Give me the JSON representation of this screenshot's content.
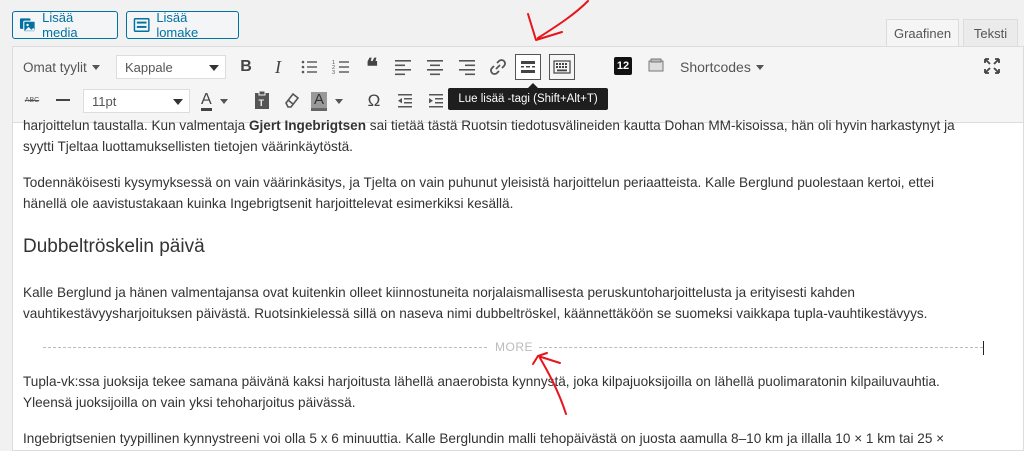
{
  "media_buttons": {
    "add_media": "Lisää media",
    "add_form": "Lisää lomake"
  },
  "tabs": {
    "visual": "Graafinen",
    "text": "Teksti"
  },
  "toolbar": {
    "styles_label": "Omat tyylit",
    "format_select": "Kappale",
    "font_size_select": "11pt",
    "counter_badge": "12",
    "shortcodes_label": "Shortcodes",
    "strikethrough_label": "ABC",
    "text_color_label": "A",
    "bg_color_label": "A",
    "omega_label": "Ω",
    "bold_label": "B",
    "italic_label": "I",
    "quote_label": "❝"
  },
  "tooltip": "Lue lisää -tagi (Shift+Alt+T)",
  "content": {
    "p1_line1_before": "harjoittelun taustalla. Kun valmentaja ",
    "p1_bold": "Gjert Ingebrigtsen",
    "p1_line1_after": " sai tietää tästä Ruotsin tiedotusvälineiden kautta Dohan MM-kisoissa, hän oli hyvin harkastynyt ja",
    "p1_line2": "syytti Tjeltaa luottamuksellisten tietojen väärinkäytöstä.",
    "p2_line1": "Todennäköisesti kysymyksessä on vain väärinkäsitys, ja Tjelta on vain puhunut yleisistä harjoittelun periaatteista. Kalle Berglund puolestaan kertoi, ettei",
    "p2_line2": "hänellä ole aavistustakaan kuinka Ingebrigtsenit harjoittelevat esimerkiksi kesällä.",
    "heading": "Dubbeltröskelin päivä",
    "p3_line1": "Kalle Berglund ja hänen valmentajansa ovat kuitenkin olleet kiinnostuneita norjalaismallisesta peruskuntoharjoittelusta ja erityisesti kahden",
    "p3_line2": "vauhtikestävyysharjoituksen päivästä. Ruotsinkielessä sillä on naseva nimi dubbeltröskel, käännettäköön se suomeksi vaikkapa tupla-vauhtikestävyys.",
    "more_label": "MORE",
    "p4_line1": "Tupla-vk:ssa juoksija tekee samana päivänä kaksi harjoitusta lähellä anaerobista kynnystä, joka kilpajuoksijoilla on lähellä puolimaratonin kilpailuvauhtia.",
    "p4_line2": "Yleensä juoksijoilla on vain yksi tehoharjoitus päivässä.",
    "p5_line1": "Ingebrigtsenien tyypillinen kynnystreeni voi olla 5 x 6 minuuttia. Kalle Berglundin malli tehopäivästä on juosta aamulla 8–10 km ja illalla 10 × 1 km tai 25 ×"
  },
  "colors": {
    "accent": "#0071a1",
    "annotation": "#e8141b",
    "tooltip_bg": "#1e1e1e"
  }
}
